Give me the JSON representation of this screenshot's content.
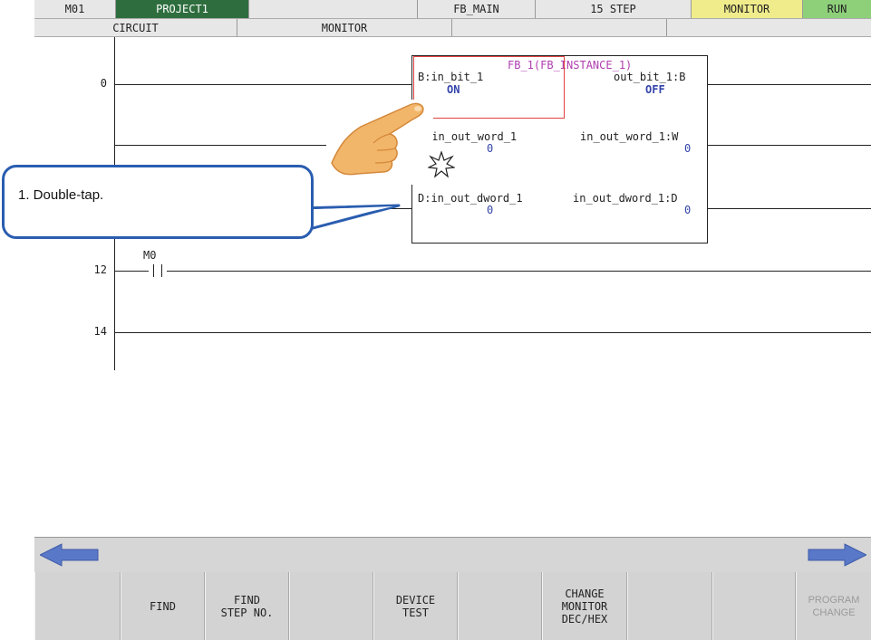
{
  "header": {
    "row1": {
      "machine": "M01",
      "project": "PROJECT1",
      "blank": "",
      "program": "FB_MAIN",
      "steps": "15 STEP",
      "mode": "MONITOR",
      "state": "RUN"
    },
    "row2": {
      "circuit": "CIRCUIT",
      "monitor": "MONITOR"
    }
  },
  "ladder": {
    "steps": [
      "0",
      "12",
      "14"
    ],
    "contact_label": "M0",
    "fb": {
      "title": "FB_1(FB_INSTANCE_1)",
      "in_bit": "B:in_bit_1",
      "in_bit_val": "ON",
      "out_bit": "out_bit_1:B",
      "out_bit_val": "OFF",
      "in_word": ":in_out_word_1",
      "in_word_val": "0",
      "out_word": "in_out_word_1:W",
      "out_word_val": "0",
      "in_dword": "D:in_out_dword_1",
      "in_dword_val": "0",
      "out_dword": "in_out_dword_1:D",
      "out_dword_val": "0"
    }
  },
  "callout": {
    "text": "1. Double-tap."
  },
  "fkeys": [
    "",
    "FIND",
    "FIND\nSTEP NO.",
    "",
    "DEVICE\nTEST",
    "",
    "CHANGE\nMONITOR\nDEC/HEX",
    "",
    "",
    "PROGRAM\nCHANGE"
  ],
  "colors": {
    "project_bg": "#2e6e3e",
    "monitor_bg": "#f0ec8c",
    "run_bg": "#8ed07a",
    "callout_border": "#2a5db0",
    "arrow": "#5a78c8",
    "fb_title": "#b03db0",
    "highlight": "#e04040"
  },
  "icons": [
    "left-arrow-icon",
    "right-arrow-icon",
    "hand-pointer-icon",
    "tap-burst-icon"
  ]
}
